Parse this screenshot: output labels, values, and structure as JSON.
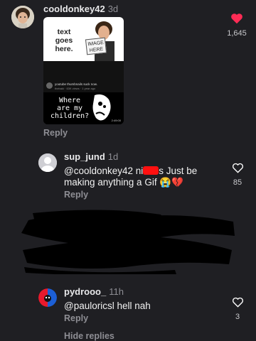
{
  "comments": [
    {
      "username": "cooldonkey42",
      "age": "3d",
      "gif": {
        "top_text": "text goes here.",
        "sign_text": "IMAGE HERE",
        "meta_title": "youtube thumbnails suck now.",
        "meta_sub": "thebaki · 63K views · 1 year ago",
        "caption": "Where are my children?",
        "duration": "2:49:00"
      },
      "reply_label": "Reply",
      "liked": true,
      "like_count": "1,645"
    },
    {
      "username": "sup_jund",
      "age": "1d",
      "text_before": "@cooldonkey42 ni",
      "text_after": "s Just be making anything a Gif 😭💔",
      "reply_label": "Reply",
      "liked": false,
      "like_count": "85"
    },
    {
      "username": "pydrooo_",
      "age": "11h",
      "text": "@pauloricsl hell nah",
      "reply_label": "Reply",
      "liked": false,
      "like_count": "3"
    }
  ],
  "hide_replies_label": "Hide replies",
  "colors": {
    "like_red": "#fe2c55",
    "background": "#1f1f23",
    "muted": "#8e8e94"
  }
}
